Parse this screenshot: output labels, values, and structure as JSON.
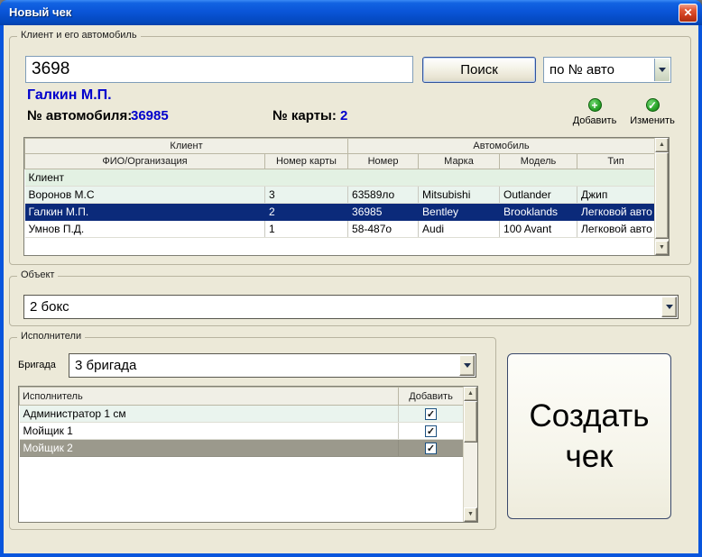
{
  "window": {
    "title": "Новый чек",
    "close_glyph": "✕"
  },
  "icons": {
    "add_glyph": "+",
    "edit_glyph": "✓",
    "check_glyph": "✓",
    "arrow_up_glyph": "▲",
    "arrow_down_glyph": "▼"
  },
  "colors": {
    "selection_navy": "#0B2A7A",
    "selection_gray": "#9B998C",
    "value_blue": "#0000CC",
    "row_green": "#E3F1E3",
    "row_pale": "#EAF4EE",
    "titlebar_blue": "#0A55D8"
  },
  "client_group": {
    "title": "Клиент и его автомобиль",
    "search_value": "3698",
    "search_button_label": "Поиск",
    "search_mode_value": "по № авто",
    "found_client_name": "Галкин М.П.",
    "car_number_label": "№ автомобиля:",
    "car_number_value": "36985",
    "card_number_label": "№ карты:",
    "card_number_value": "2",
    "add_label": "Добавить",
    "edit_label": "Изменить",
    "table": {
      "group_headers": [
        "Клиент",
        "Автомобиль"
      ],
      "columns": [
        "ФИО/Организация",
        "Номер карты",
        "Номер",
        "Марка",
        "Модель",
        "Тип"
      ],
      "group_row_label": "Клиент",
      "selected_index": 1,
      "rows": [
        {
          "fio": "Воронов М.С",
          "card": "3",
          "number": "63589ло",
          "brand": "Mitsubishi",
          "model": "Outlander",
          "type": "Джип"
        },
        {
          "fio": "Галкин М.П.",
          "card": "2",
          "number": "36985",
          "brand": "Bentley",
          "model": "Brooklands",
          "type": "Легковой авто"
        },
        {
          "fio": "Умнов П.Д.",
          "card": "1",
          "number": "58-487о",
          "brand": "Audi",
          "model": "100 Avant",
          "type": "Легковой авто"
        }
      ]
    }
  },
  "object_group": {
    "title": "Объект",
    "selected_value": "2 бокс"
  },
  "executors_group": {
    "title": "Исполнители",
    "brigade_label": "Бригада",
    "brigade_value": "3 бригада",
    "table": {
      "columns": [
        "Исполнитель",
        "Добавить"
      ],
      "selected_index": 2,
      "rows": [
        {
          "name": "Администратор 1 см",
          "checked": true
        },
        {
          "name": "Мойщик 1",
          "checked": true
        },
        {
          "name": "Мойщик 2",
          "checked": true
        }
      ]
    }
  },
  "create_button_label": "Создать чек"
}
